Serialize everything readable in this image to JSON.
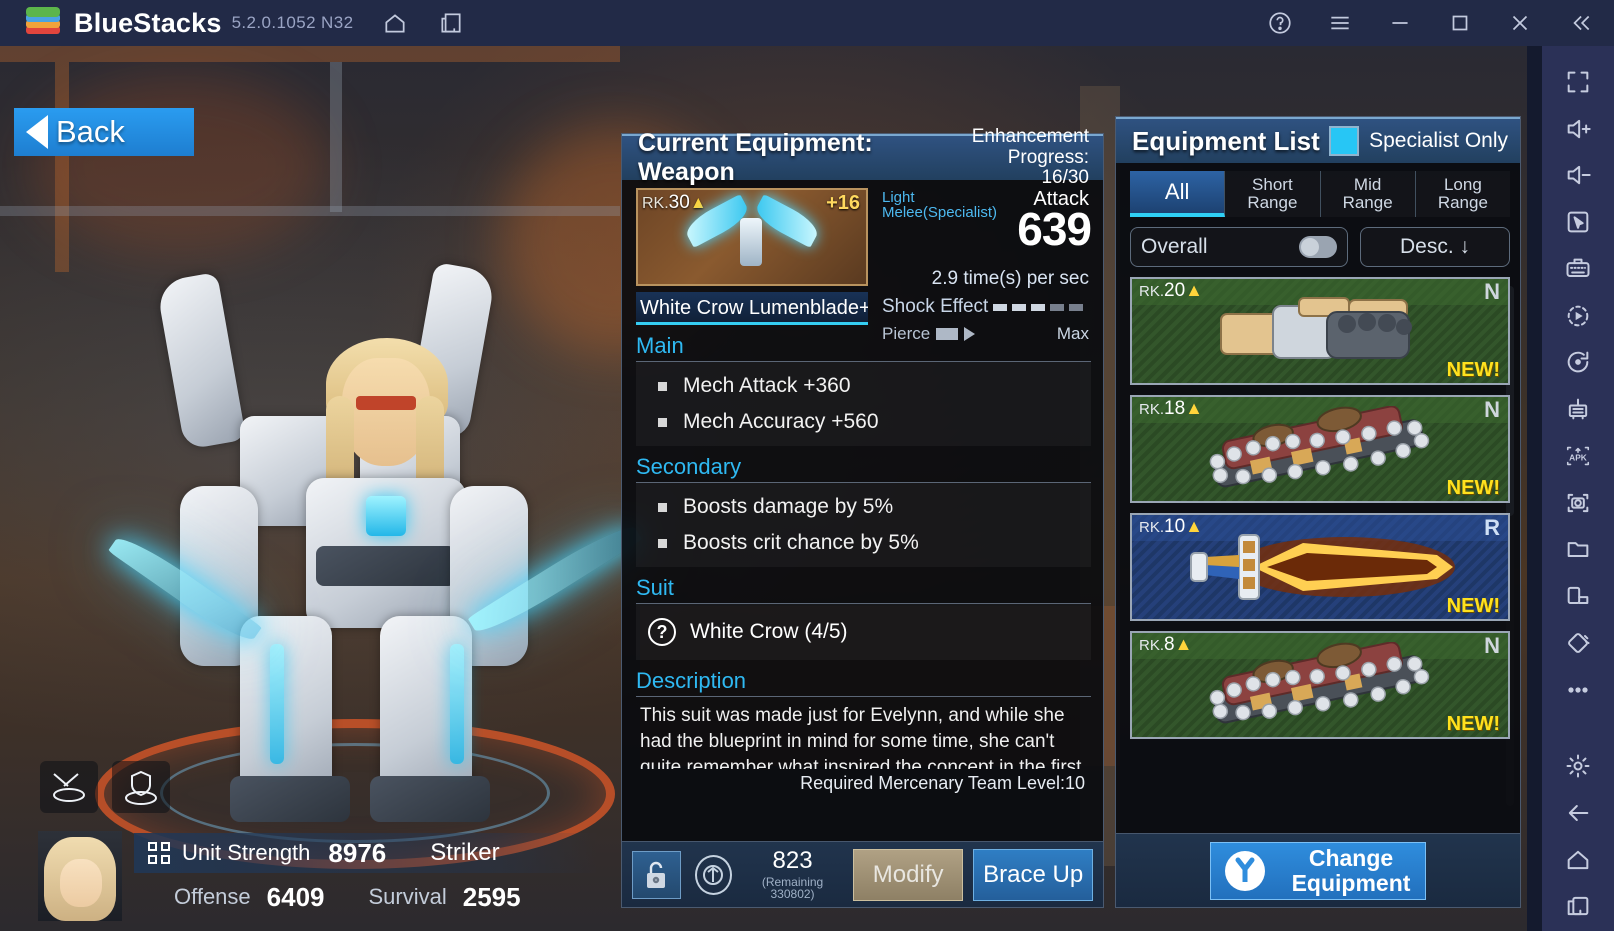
{
  "titlebar": {
    "app_name": "BlueStacks",
    "version": "5.2.0.1052 N32",
    "icons": [
      "home-icon",
      "multi-instance-icon"
    ],
    "right_icons": [
      "help-icon",
      "menu-icon",
      "minimize-icon",
      "maximize-icon",
      "close-icon",
      "collapse-icon"
    ]
  },
  "sidebar": {
    "items": [
      {
        "name": "fullscreen-icon"
      },
      {
        "name": "volume-up-icon"
      },
      {
        "name": "volume-down-icon"
      },
      {
        "name": "cursor-icon"
      },
      {
        "name": "keyboard-controls-icon"
      },
      {
        "name": "macro-record-icon"
      },
      {
        "name": "rotate-icon"
      },
      {
        "name": "eco-mode-icon"
      },
      {
        "name": "install-apk-icon",
        "label": "APK"
      },
      {
        "name": "screenshot-icon"
      },
      {
        "name": "media-folder-icon"
      },
      {
        "name": "multi-window-icon"
      },
      {
        "name": "shake-icon"
      },
      {
        "name": "more-icon"
      },
      {
        "name": "settings-gear-icon"
      },
      {
        "name": "back-arrow-icon"
      },
      {
        "name": "home-icon"
      },
      {
        "name": "recents-icon"
      }
    ]
  },
  "back_button": {
    "label": "Back",
    "ghost_label": "BACK"
  },
  "equipment_detail": {
    "title": "Current Equipment: Weapon",
    "enhancement_label": "Enhancement",
    "progress_label": "Progress: 16/30",
    "item": {
      "rank_prefix": "RK.",
      "rank": "30",
      "enhance": "+16",
      "name": "White Crow Lumenblade+16"
    },
    "stats": {
      "type_line1": "Light",
      "type_line2": "Melee(Specialist)",
      "attack_label": "Attack",
      "attack_value": "639",
      "rate": "2.9 time(s) per sec",
      "shock_label": "Shock Effect",
      "shock_pips": [
        true,
        true,
        true,
        false,
        false
      ],
      "pierce_label": "Pierce",
      "pierce_max": "Max"
    },
    "sections": [
      {
        "label": "Main",
        "items": [
          "Mech Attack +360",
          "Mech Accuracy +560"
        ]
      },
      {
        "label": "Secondary",
        "items": [
          "Boosts damage by 5%",
          "Boosts crit chance by 5%"
        ]
      }
    ],
    "suit": {
      "label": "Suit",
      "name": "White Crow (4/5)",
      "help_icon": "question-mark-icon"
    },
    "description": {
      "label": "Description",
      "text": "This suit was made just for Evelynn, and while she had the blueprint in mind for some time, she can't quite remember what inspired the concept in the first place."
    },
    "required_level": "Required Mercenary Team Level:10",
    "footer": {
      "lock_icon": "unlocked-padlock-icon",
      "currency_icon": "currency-token-icon",
      "currency_value": "823",
      "currency_remaining": "(Remaining 330802)",
      "modify_label": "Modify",
      "brace_up_label": "Brace Up"
    }
  },
  "equipment_list": {
    "title": "Equipment List",
    "specialist_only_label": "Specialist Only",
    "specialist_only_checked": true,
    "tabs": [
      {
        "label": "All",
        "active": true
      },
      {
        "label": "Short\nRange",
        "line1": "Short",
        "line2": "Range",
        "active": false
      },
      {
        "label": "Mid\nRange",
        "line1": "Mid",
        "line2": "Range",
        "active": false
      },
      {
        "label": "Long\nRange",
        "line1": "Long",
        "line2": "Range",
        "active": false
      }
    ],
    "filter_label": "Overall",
    "sort_label": "Desc. ↓",
    "items": [
      {
        "rank_prefix": "RK.",
        "rank": "20",
        "grade": "N",
        "new_tag": "NEW!",
        "rarity": "n",
        "art": "gauntlet-icon"
      },
      {
        "rank_prefix": "RK.",
        "rank": "18",
        "grade": "N",
        "new_tag": "NEW!",
        "rarity": "n",
        "art": "chainsaw-icon"
      },
      {
        "rank_prefix": "RK.",
        "rank": "10",
        "grade": "R",
        "new_tag": "NEW!",
        "rarity": "r",
        "art": "flame-sword-icon"
      },
      {
        "rank_prefix": "RK.",
        "rank": "8",
        "grade": "N",
        "new_tag": "NEW!",
        "rarity": "n",
        "art": "chainsaw-icon"
      }
    ],
    "change_equipment": {
      "line1": "Change",
      "line2": "Equipment",
      "icon": "wrench-icon"
    }
  },
  "unit_status": {
    "unit_strength_label": "Unit Strength",
    "unit_strength_value": "8976",
    "role": "Striker",
    "offense_label": "Offense",
    "offense_value": "6409",
    "survival_label": "Survival",
    "survival_value": "2595",
    "avatar": "character-portrait"
  },
  "colors": {
    "accent_blue": "#2fd0f5",
    "panel_header": "#2f5281",
    "button_blue": "#2f8ddd",
    "new_tag": "#ffe11e",
    "gold": "#ffd43b"
  }
}
